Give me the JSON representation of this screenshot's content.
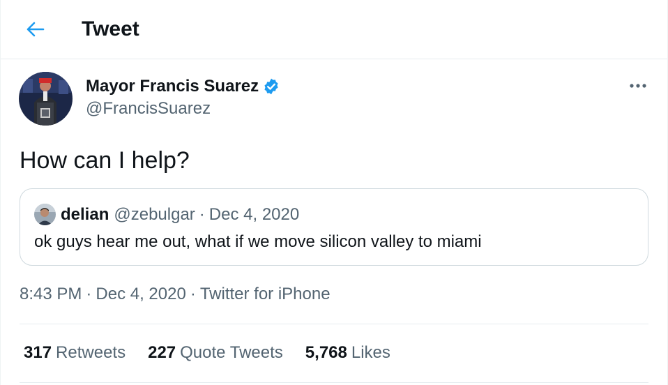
{
  "header": {
    "title": "Tweet",
    "back_icon": "arrow-left-icon"
  },
  "colors": {
    "accent": "#1d9bf0",
    "text": "#0f1419",
    "secondary": "#536471",
    "border": "#cfd9de"
  },
  "tweet": {
    "author_name": "Mayor Francis Suarez",
    "author_handle": "@FrancisSuarez",
    "verified_icon": "verified-badge-icon",
    "more_icon": "more-options-icon",
    "text": "How can I help?",
    "time": "8:43 PM",
    "date": "Dec 4, 2020",
    "source": "Twitter for iPhone",
    "separator": "·"
  },
  "quote": {
    "author_name": "delian",
    "author_handle": "@zebulgar",
    "separator": "·",
    "date": "Dec 4, 2020",
    "text": "ok guys hear me out, what if we move silicon valley to miami"
  },
  "stats": {
    "retweets_count": "317",
    "retweets_label": "Retweets",
    "quotes_count": "227",
    "quotes_label": "Quote Tweets",
    "likes_count": "5,768",
    "likes_label": "Likes"
  }
}
